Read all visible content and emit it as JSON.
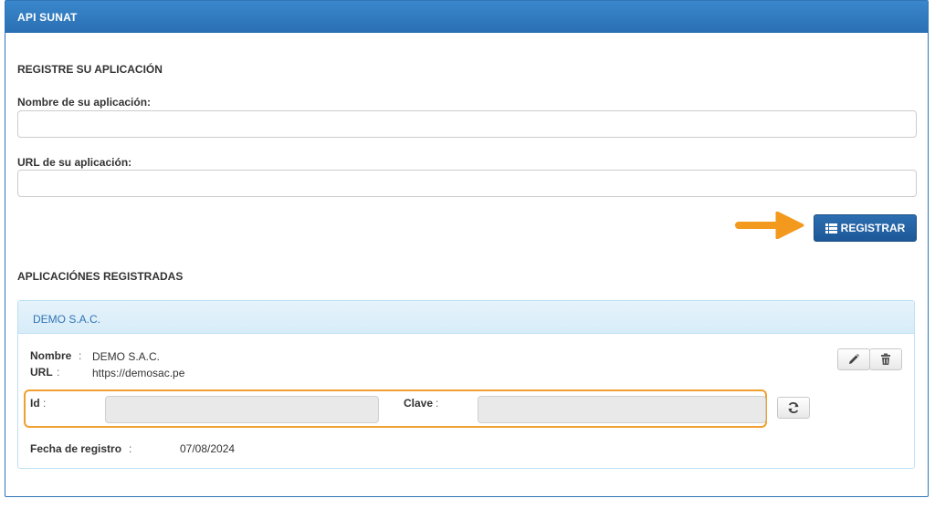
{
  "panel": {
    "title": "API SUNAT"
  },
  "register": {
    "section_title": "REGISTRE SU APLICACIÓN",
    "name_label": "Nombre de su aplicación:",
    "name_value": "",
    "url_label": "URL de su aplicación:",
    "url_value": "",
    "submit_label": "REGISTRAR"
  },
  "registered": {
    "section_title": "APLICACIÓNES REGISTRADAS",
    "apps": [
      {
        "header": "DEMO S.A.C.",
        "name_label": "Nombre",
        "name_value": "DEMO S.A.C.",
        "url_label": "URL",
        "url_value": "https://demosac.pe",
        "id_label": "Id",
        "id_value": "",
        "key_label": "Clave",
        "key_value": "",
        "date_label": "Fecha de registro",
        "date_value": "07/08/2024"
      }
    ]
  },
  "colors": {
    "header_blue": "#2f74b5",
    "button_blue": "#1d5898",
    "highlight_orange": "#f0a030",
    "arrow_orange": "#f39a1e"
  },
  "icons": [
    "list-icon",
    "arrow-right-icon",
    "pencil-icon",
    "trash-icon",
    "refresh-icon"
  ]
}
